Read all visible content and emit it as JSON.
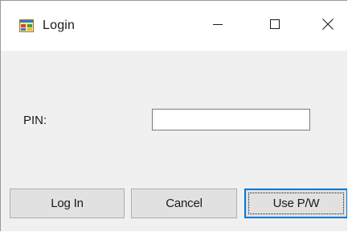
{
  "window": {
    "title": "Login",
    "icon": "app-window-icon"
  },
  "title_buttons": {
    "minimize_icon": "minimize-icon",
    "maximize_icon": "maximize-icon",
    "close_icon": "close-icon"
  },
  "form": {
    "pin_label": "PIN:",
    "pin_value": "",
    "pin_placeholder": ""
  },
  "buttons": {
    "login_label": "Log In",
    "cancel_label": "Cancel",
    "use_pw_label": "Use P/W"
  },
  "colors": {
    "focus_accent": "#0078d7",
    "button_face": "#e1e1e1",
    "window_background": "#f0f0f0"
  }
}
